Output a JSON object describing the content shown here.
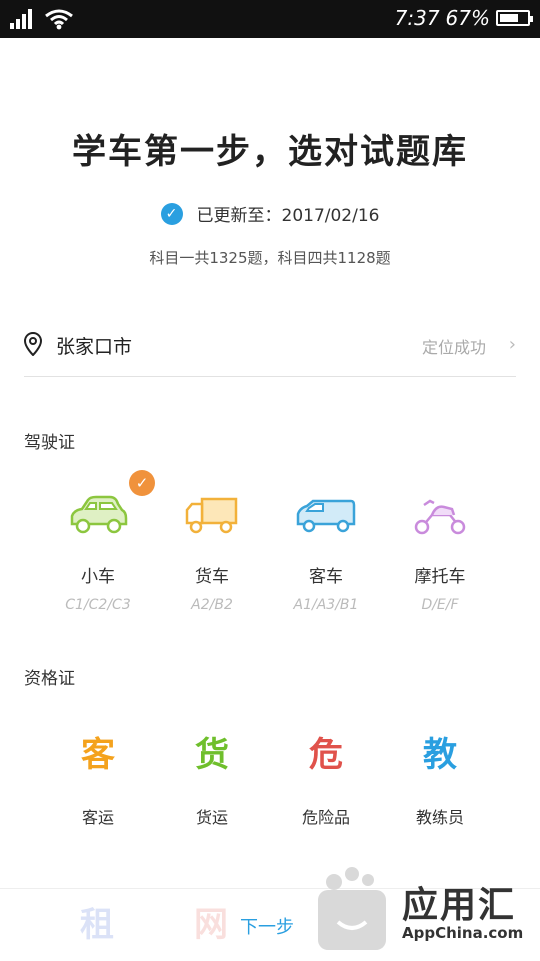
{
  "status_bar": {
    "time": "7:37",
    "battery": "67%"
  },
  "header": {
    "title": "学车第一步，选对试题库",
    "update_text": "已更新至：2017/02/16",
    "subject_counts": "科目一共1325题，科目四共1128题"
  },
  "location": {
    "city": "张家口市",
    "status": "定位成功"
  },
  "driver_license": {
    "title": "驾驶证",
    "items": [
      {
        "name": "小车",
        "code": "C1/C2/C3",
        "color": "#8cc63f",
        "selected": true
      },
      {
        "name": "货车",
        "code": "A2/B2",
        "color": "#f2b13a"
      },
      {
        "name": "客车",
        "code": "A1/A3/B1",
        "color": "#3aa3d9"
      },
      {
        "name": "摩托车",
        "code": "D/E/F",
        "color": "#c98bdc"
      }
    ]
  },
  "qualification": {
    "title": "资格证",
    "items": [
      {
        "glyph": "客",
        "label": "客运",
        "color": "#f4a21d"
      },
      {
        "glyph": "货",
        "label": "货运",
        "color": "#6fbf2c"
      },
      {
        "glyph": "危",
        "label": "危险品",
        "color": "#e0524b"
      },
      {
        "glyph": "教",
        "label": "教练员",
        "color": "#2a9fe0"
      }
    ],
    "more": [
      {
        "glyph": "租",
        "color": "#3c62d6"
      },
      {
        "glyph": "网",
        "color": "#e0524b"
      }
    ]
  },
  "footer": {
    "next_label": "下一步"
  },
  "watermark": {
    "brand": "应用汇",
    "sub": "AppChina.com"
  },
  "colors": {
    "accent": "#2a9fe0",
    "badge": "#f0923c"
  }
}
